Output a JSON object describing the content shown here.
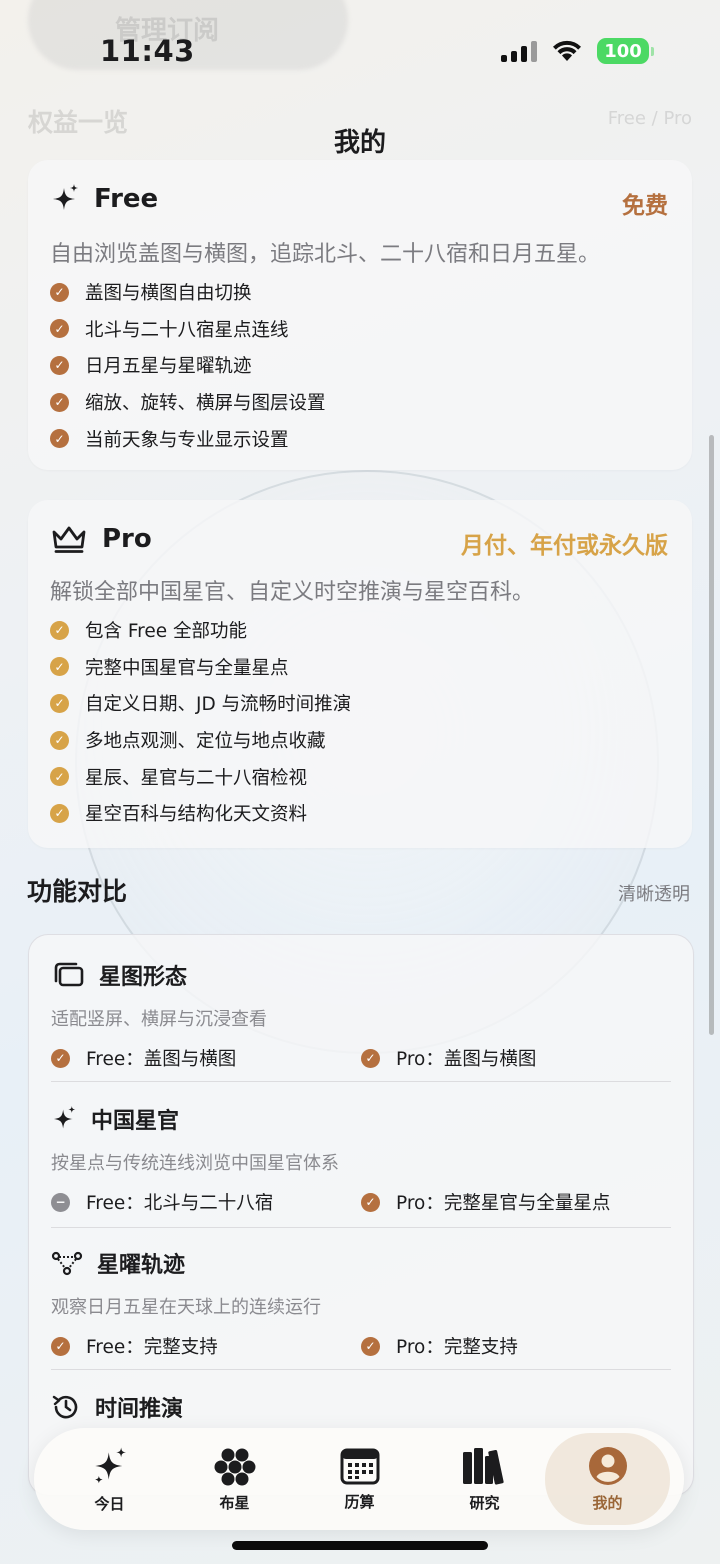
{
  "status": {
    "time": "11:43",
    "battery": "100"
  },
  "nav": {
    "title": "我的"
  },
  "ghost": {
    "top_button": "管理订阅",
    "benefits_title": "权益一览",
    "benefits_hint": "Free / Pro"
  },
  "plans": {
    "free": {
      "name": "Free",
      "price": "免费",
      "desc": "自由浏览盖图与横图，追踪北斗、二十八宿和日月五星。",
      "features": [
        "盖图与横图自由切换",
        "北斗与二十八宿星点连线",
        "日月五星与星曜轨迹",
        "缩放、旋转、横屏与图层设置",
        "当前天象与专业显示设置"
      ]
    },
    "pro": {
      "name": "Pro",
      "price": "月付、年付或永久版",
      "desc": "解锁全部中国星官、自定义时空推演与星空百科。",
      "features": [
        "包含 Free 全部功能",
        "完整中国星官与全量星点",
        "自定义日期、JD 与流畅时间推演",
        "多地点观测、定位与地点收藏",
        "星辰、星官与二十八宿检视",
        "星空百科与结构化天文资料"
      ]
    }
  },
  "comparison": {
    "title": "功能对比",
    "hint": "清晰透明",
    "rows": [
      {
        "title": "星图形态",
        "desc": "适配竖屏、横屏与沉浸查看",
        "free": "Free：盖图与横图",
        "pro": "Pro：盖图与横图"
      },
      {
        "title": "中国星官",
        "desc": "按星点与传统连线浏览中国星官体系",
        "free": "Free：北斗与二十八宿",
        "pro": "Pro：完整星官与全量星点"
      },
      {
        "title": "星曜轨迹",
        "desc": "观察日月五星在天球上的连续运行",
        "free": "Free：完整支持",
        "pro": "Pro：完整支持"
      },
      {
        "title": "时间推演"
      }
    ]
  },
  "tabs": [
    "今日",
    "布星",
    "历算",
    "研究",
    "我的"
  ],
  "colors": {
    "brown": "#b5703f",
    "gold": "#d7a348",
    "accent_active": "#9a6637"
  }
}
